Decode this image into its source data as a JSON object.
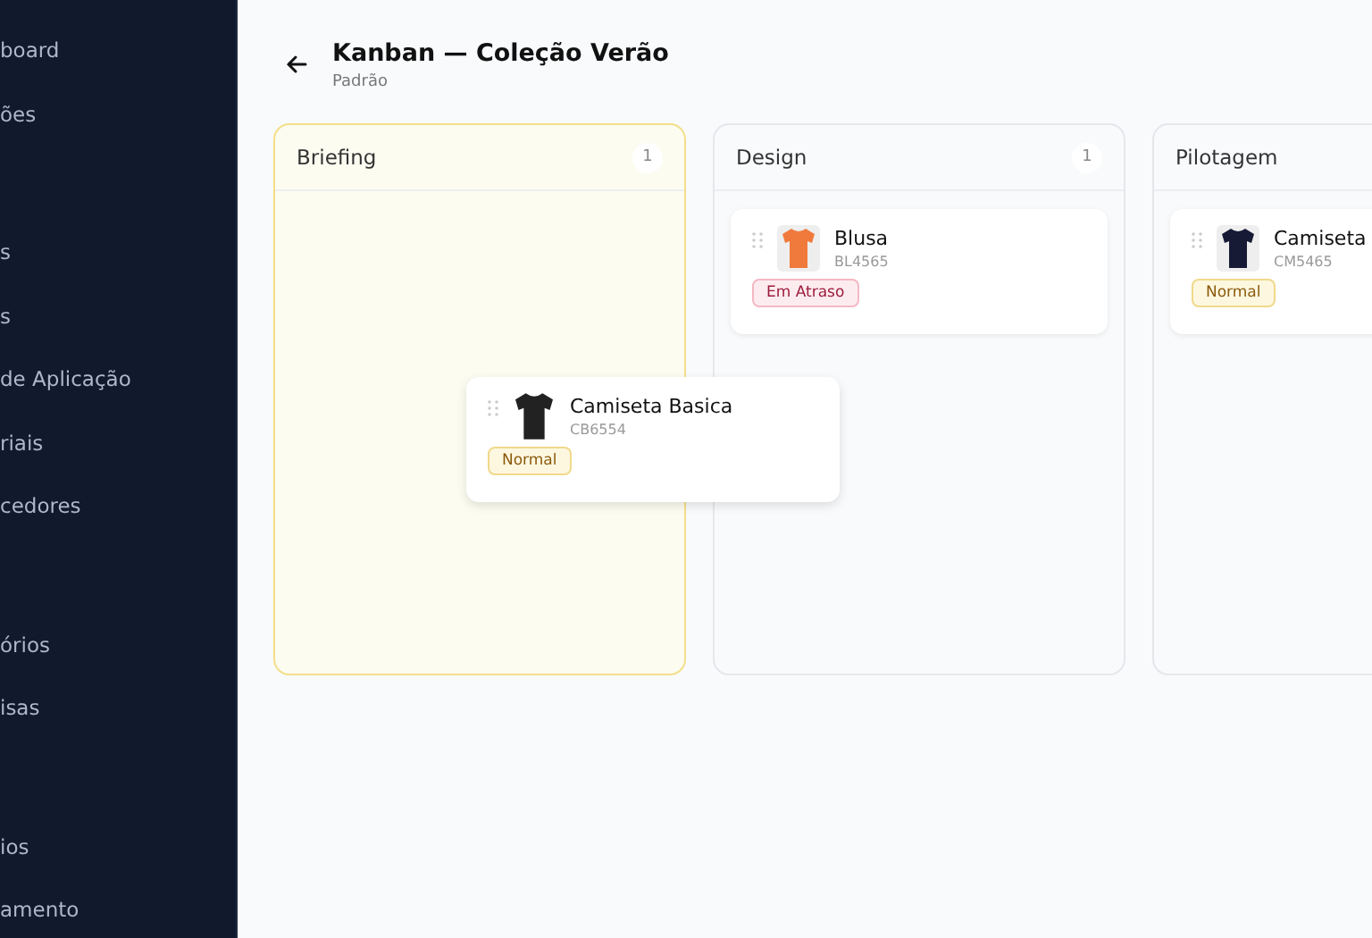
{
  "sidebar": {
    "groups": [
      {
        "items": [
          "board",
          "ões"
        ]
      },
      {
        "items": [
          "s",
          "s",
          "de Aplicação",
          "riais",
          "cedores"
        ]
      },
      {
        "items": [
          "órios",
          "isas"
        ]
      },
      {
        "items": [
          "ios",
          "amento"
        ]
      }
    ]
  },
  "header": {
    "title": "Kanban — Coleção Verão",
    "subtitle": "Padrão"
  },
  "columns": [
    {
      "title": "Briefing",
      "count": "1",
      "highlighted": true
    },
    {
      "title": "Design",
      "count": "1",
      "highlighted": false,
      "cards": [
        {
          "name": "Blusa",
          "code": "BL4565",
          "color": "#f07a3c",
          "badge": "Em Atraso",
          "kind": "late"
        }
      ]
    },
    {
      "title": "Pilotagem",
      "highlighted": false,
      "cards": [
        {
          "name": "Camiseta",
          "code": "CM5465",
          "color": "#161a35",
          "badge": "Normal",
          "kind": "normal"
        }
      ]
    }
  ],
  "dragging_card": {
    "name": "Camiseta Basica",
    "code": "CB6554",
    "color": "#222222",
    "badge": "Normal",
    "kind": "normal"
  }
}
